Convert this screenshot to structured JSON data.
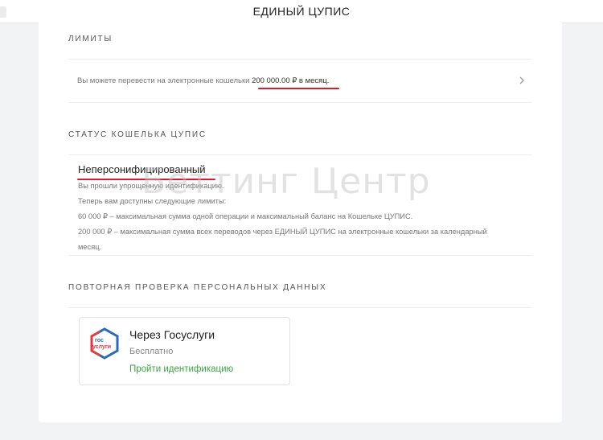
{
  "header": {
    "title": "ЕДИНЫЙ ЦУПИС"
  },
  "limits": {
    "section_title": "ЛИМИТЫ",
    "text_prefix": "Вы можете перевести на электронные кошельки ",
    "amount": "200 000.00 ₽ в месяц."
  },
  "status": {
    "section_title": "СТАТУС КОШЕЛЬКА ЦУПИС",
    "name": "Неперсонифицированный",
    "lines": [
      "Вы прошли упрощенную идентификацию.",
      "Теперь вам доступны следующие лимиты:",
      "60 000 ₽ – максимальная сумма одной операции и максимальный баланс на Кошельке ЦУПИС.",
      "200 000 ₽ – максимальная сумма всех переводов через ЕДИНЫЙ ЦУПИС на электронные кошельки за календарный",
      "месяц."
    ]
  },
  "verification": {
    "section_title": "ПОВТОРНАЯ ПРОВЕРКА ПЕРСОНАЛЬНЫХ ДАННЫХ",
    "option": {
      "title": "Через Госуслуги",
      "subtitle": "Бесплатно",
      "link": "Пройти идентификацию",
      "logo_text_top": "гос",
      "logo_text_bottom": "услуги"
    }
  },
  "watermark": "Беттинг Центр",
  "colors": {
    "accent_red": "#d21e2d",
    "link_green": "#3aa644",
    "gos_blue": "#2a6ab8",
    "gos_red": "#e2383f"
  },
  "icons": {
    "chevron": "chevron-right-icon",
    "logo": "gosuslugi-logo-icon"
  }
}
